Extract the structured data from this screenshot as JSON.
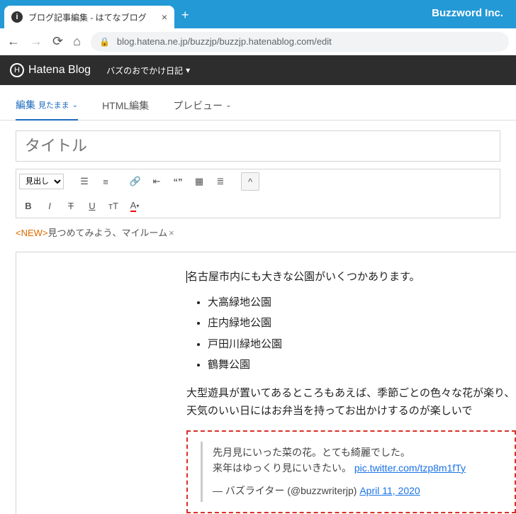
{
  "chrome": {
    "tab_title": "ブログ記事編集 - はてなブログ",
    "buzzword": "Buzzword Inc.",
    "url": "blog.hatena.ne.jp/buzzjp/buzzjp.hatenablog.com/edit"
  },
  "app": {
    "logo": "Hatena Blog",
    "blog_name": "バズのおでかけ日記"
  },
  "editor_tabs": {
    "edit": "編集",
    "edit_sub": "見たまま",
    "html": "HTML編集",
    "preview": "プレビュー"
  },
  "title_placeholder": "タイトル",
  "heading_select": "見出し",
  "tag": {
    "new": "<NEW>",
    "text": "見つめてみよう、マイルーム",
    "x": "×"
  },
  "content": {
    "p1": "名古屋市内にも大きな公園がいくつかあります。",
    "parks": [
      "大高緑地公園",
      "庄内緑地公園",
      "戸田川緑地公園",
      "鶴舞公園"
    ],
    "p2": "大型遊具が置いてあるところもあえば、季節ごとの色々な花が楽り、天気のいい日にはお弁当を持ってお出かけするのが楽しいで"
  },
  "tweet": {
    "line1": "先月見にいった菜の花。とても綺麗でした。",
    "line2_pre": "来年はゆっくり見にいきたい。 ",
    "pic_link": "pic.twitter.com/tzp8m1fTy",
    "author": "— バズライター (@buzzwriterjp) ",
    "date": "April 11, 2020"
  }
}
